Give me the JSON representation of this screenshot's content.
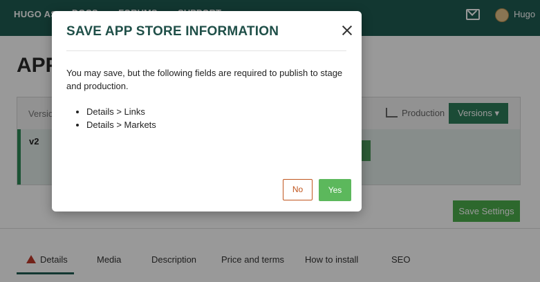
{
  "topbar": {
    "brand": "HUGO AS",
    "nav": [
      "DOCS",
      "FORUMS",
      "SUPPORT"
    ],
    "username": "Hugo"
  },
  "page": {
    "title": "APP",
    "version_label": "Versio",
    "production_label": "Production",
    "versions_button": "Versions ▾",
    "version_name": "v2",
    "save_settings": "Save Settings"
  },
  "tabs": [
    {
      "label": "Details",
      "active": true
    },
    {
      "label": "Media"
    },
    {
      "label": "Description"
    },
    {
      "label": "Price and terms"
    },
    {
      "label": "How to install"
    },
    {
      "label": "SEO"
    }
  ],
  "modal": {
    "title": "SAVE APP STORE INFORMATION",
    "message": "You may save, but the following fields are required to publish to stage and production.",
    "items": [
      "Details > Links",
      "Details > Markets"
    ],
    "no_label": "No",
    "yes_label": "Yes"
  },
  "colors": {
    "header": "#1f5c52",
    "primary_green": "#5cb85c",
    "no_border": "#c0551d"
  }
}
